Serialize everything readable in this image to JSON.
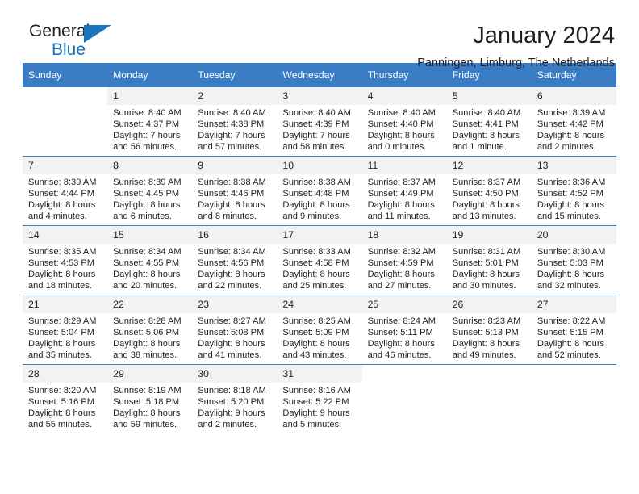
{
  "brand": {
    "name_top": "General",
    "name_bottom": "Blue",
    "triangle_color": "#1b75bb"
  },
  "header": {
    "title": "January 2024",
    "subtitle": "Panningen, Limburg, The Netherlands"
  },
  "theme": {
    "header_blue": "#3b7dc4",
    "daynum_band": "#f2f2f2",
    "text": "#231f20"
  },
  "weekday_headers": [
    "Sunday",
    "Monday",
    "Tuesday",
    "Wednesday",
    "Thursday",
    "Friday",
    "Saturday"
  ],
  "weeks": [
    [
      {
        "day": "",
        "sunrise": "",
        "sunset": "",
        "daylight_line1": "",
        "daylight_line2": "",
        "blank": true
      },
      {
        "day": "1",
        "sunrise": "Sunrise: 8:40 AM",
        "sunset": "Sunset: 4:37 PM",
        "daylight_line1": "Daylight: 7 hours",
        "daylight_line2": "and 56 minutes."
      },
      {
        "day": "2",
        "sunrise": "Sunrise: 8:40 AM",
        "sunset": "Sunset: 4:38 PM",
        "daylight_line1": "Daylight: 7 hours",
        "daylight_line2": "and 57 minutes."
      },
      {
        "day": "3",
        "sunrise": "Sunrise: 8:40 AM",
        "sunset": "Sunset: 4:39 PM",
        "daylight_line1": "Daylight: 7 hours",
        "daylight_line2": "and 58 minutes."
      },
      {
        "day": "4",
        "sunrise": "Sunrise: 8:40 AM",
        "sunset": "Sunset: 4:40 PM",
        "daylight_line1": "Daylight: 8 hours",
        "daylight_line2": "and 0 minutes."
      },
      {
        "day": "5",
        "sunrise": "Sunrise: 8:40 AM",
        "sunset": "Sunset: 4:41 PM",
        "daylight_line1": "Daylight: 8 hours",
        "daylight_line2": "and 1 minute."
      },
      {
        "day": "6",
        "sunrise": "Sunrise: 8:39 AM",
        "sunset": "Sunset: 4:42 PM",
        "daylight_line1": "Daylight: 8 hours",
        "daylight_line2": "and 2 minutes."
      }
    ],
    [
      {
        "day": "7",
        "sunrise": "Sunrise: 8:39 AM",
        "sunset": "Sunset: 4:44 PM",
        "daylight_line1": "Daylight: 8 hours",
        "daylight_line2": "and 4 minutes."
      },
      {
        "day": "8",
        "sunrise": "Sunrise: 8:39 AM",
        "sunset": "Sunset: 4:45 PM",
        "daylight_line1": "Daylight: 8 hours",
        "daylight_line2": "and 6 minutes."
      },
      {
        "day": "9",
        "sunrise": "Sunrise: 8:38 AM",
        "sunset": "Sunset: 4:46 PM",
        "daylight_line1": "Daylight: 8 hours",
        "daylight_line2": "and 8 minutes."
      },
      {
        "day": "10",
        "sunrise": "Sunrise: 8:38 AM",
        "sunset": "Sunset: 4:48 PM",
        "daylight_line1": "Daylight: 8 hours",
        "daylight_line2": "and 9 minutes."
      },
      {
        "day": "11",
        "sunrise": "Sunrise: 8:37 AM",
        "sunset": "Sunset: 4:49 PM",
        "daylight_line1": "Daylight: 8 hours",
        "daylight_line2": "and 11 minutes."
      },
      {
        "day": "12",
        "sunrise": "Sunrise: 8:37 AM",
        "sunset": "Sunset: 4:50 PM",
        "daylight_line1": "Daylight: 8 hours",
        "daylight_line2": "and 13 minutes."
      },
      {
        "day": "13",
        "sunrise": "Sunrise: 8:36 AM",
        "sunset": "Sunset: 4:52 PM",
        "daylight_line1": "Daylight: 8 hours",
        "daylight_line2": "and 15 minutes."
      }
    ],
    [
      {
        "day": "14",
        "sunrise": "Sunrise: 8:35 AM",
        "sunset": "Sunset: 4:53 PM",
        "daylight_line1": "Daylight: 8 hours",
        "daylight_line2": "and 18 minutes."
      },
      {
        "day": "15",
        "sunrise": "Sunrise: 8:34 AM",
        "sunset": "Sunset: 4:55 PM",
        "daylight_line1": "Daylight: 8 hours",
        "daylight_line2": "and 20 minutes."
      },
      {
        "day": "16",
        "sunrise": "Sunrise: 8:34 AM",
        "sunset": "Sunset: 4:56 PM",
        "daylight_line1": "Daylight: 8 hours",
        "daylight_line2": "and 22 minutes."
      },
      {
        "day": "17",
        "sunrise": "Sunrise: 8:33 AM",
        "sunset": "Sunset: 4:58 PM",
        "daylight_line1": "Daylight: 8 hours",
        "daylight_line2": "and 25 minutes."
      },
      {
        "day": "18",
        "sunrise": "Sunrise: 8:32 AM",
        "sunset": "Sunset: 4:59 PM",
        "daylight_line1": "Daylight: 8 hours",
        "daylight_line2": "and 27 minutes."
      },
      {
        "day": "19",
        "sunrise": "Sunrise: 8:31 AM",
        "sunset": "Sunset: 5:01 PM",
        "daylight_line1": "Daylight: 8 hours",
        "daylight_line2": "and 30 minutes."
      },
      {
        "day": "20",
        "sunrise": "Sunrise: 8:30 AM",
        "sunset": "Sunset: 5:03 PM",
        "daylight_line1": "Daylight: 8 hours",
        "daylight_line2": "and 32 minutes."
      }
    ],
    [
      {
        "day": "21",
        "sunrise": "Sunrise: 8:29 AM",
        "sunset": "Sunset: 5:04 PM",
        "daylight_line1": "Daylight: 8 hours",
        "daylight_line2": "and 35 minutes."
      },
      {
        "day": "22",
        "sunrise": "Sunrise: 8:28 AM",
        "sunset": "Sunset: 5:06 PM",
        "daylight_line1": "Daylight: 8 hours",
        "daylight_line2": "and 38 minutes."
      },
      {
        "day": "23",
        "sunrise": "Sunrise: 8:27 AM",
        "sunset": "Sunset: 5:08 PM",
        "daylight_line1": "Daylight: 8 hours",
        "daylight_line2": "and 41 minutes."
      },
      {
        "day": "24",
        "sunrise": "Sunrise: 8:25 AM",
        "sunset": "Sunset: 5:09 PM",
        "daylight_line1": "Daylight: 8 hours",
        "daylight_line2": "and 43 minutes."
      },
      {
        "day": "25",
        "sunrise": "Sunrise: 8:24 AM",
        "sunset": "Sunset: 5:11 PM",
        "daylight_line1": "Daylight: 8 hours",
        "daylight_line2": "and 46 minutes."
      },
      {
        "day": "26",
        "sunrise": "Sunrise: 8:23 AM",
        "sunset": "Sunset: 5:13 PM",
        "daylight_line1": "Daylight: 8 hours",
        "daylight_line2": "and 49 minutes."
      },
      {
        "day": "27",
        "sunrise": "Sunrise: 8:22 AM",
        "sunset": "Sunset: 5:15 PM",
        "daylight_line1": "Daylight: 8 hours",
        "daylight_line2": "and 52 minutes."
      }
    ],
    [
      {
        "day": "28",
        "sunrise": "Sunrise: 8:20 AM",
        "sunset": "Sunset: 5:16 PM",
        "daylight_line1": "Daylight: 8 hours",
        "daylight_line2": "and 55 minutes."
      },
      {
        "day": "29",
        "sunrise": "Sunrise: 8:19 AM",
        "sunset": "Sunset: 5:18 PM",
        "daylight_line1": "Daylight: 8 hours",
        "daylight_line2": "and 59 minutes."
      },
      {
        "day": "30",
        "sunrise": "Sunrise: 8:18 AM",
        "sunset": "Sunset: 5:20 PM",
        "daylight_line1": "Daylight: 9 hours",
        "daylight_line2": "and 2 minutes."
      },
      {
        "day": "31",
        "sunrise": "Sunrise: 8:16 AM",
        "sunset": "Sunset: 5:22 PM",
        "daylight_line1": "Daylight: 9 hours",
        "daylight_line2": "and 5 minutes."
      },
      {
        "day": "",
        "sunrise": "",
        "sunset": "",
        "daylight_line1": "",
        "daylight_line2": "",
        "blank": true
      },
      {
        "day": "",
        "sunrise": "",
        "sunset": "",
        "daylight_line1": "",
        "daylight_line2": "",
        "blank": true
      },
      {
        "day": "",
        "sunrise": "",
        "sunset": "",
        "daylight_line1": "",
        "daylight_line2": "",
        "blank": true
      }
    ]
  ]
}
